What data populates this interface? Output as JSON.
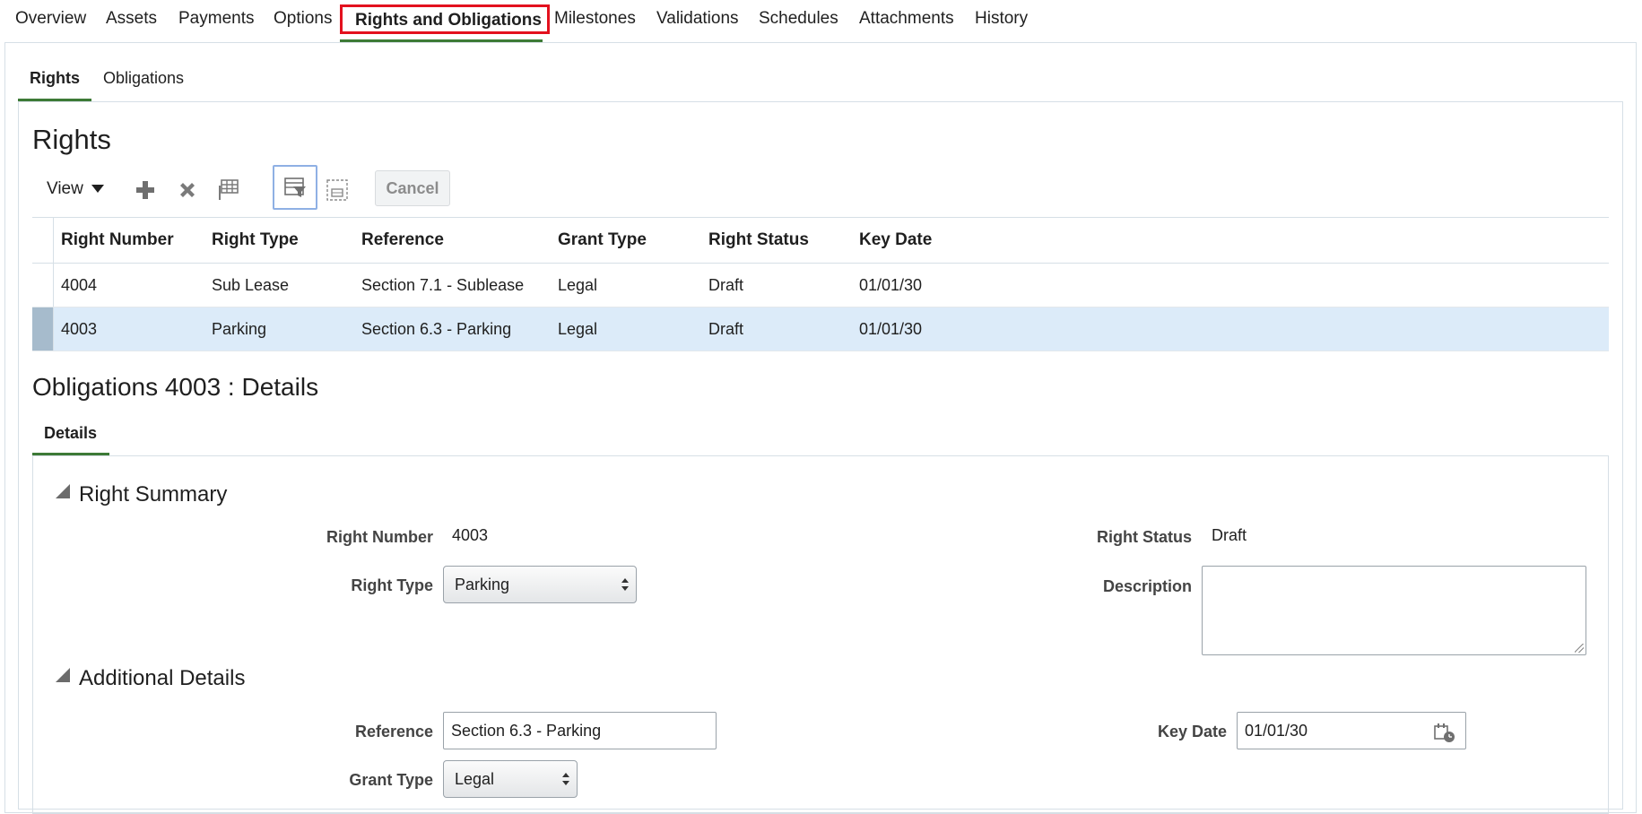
{
  "top_tabs": [
    {
      "label": "Overview"
    },
    {
      "label": "Assets"
    },
    {
      "label": "Payments"
    },
    {
      "label": "Options"
    },
    {
      "label": "Rights and Obligations"
    },
    {
      "label": "Milestones"
    },
    {
      "label": "Validations"
    },
    {
      "label": "Schedules"
    },
    {
      "label": "Attachments"
    },
    {
      "label": "History"
    }
  ],
  "active_top_tab": "Rights and Obligations",
  "sub_tabs": [
    {
      "label": "Rights"
    },
    {
      "label": "Obligations"
    }
  ],
  "rights": {
    "title": "Rights",
    "toolbar": {
      "view_label": "View",
      "cancel_label": "Cancel",
      "icons": [
        "add-icon",
        "delete-icon",
        "freeze-icon",
        "query-by-example-icon",
        "detach-icon"
      ]
    },
    "columns": [
      "Right Number",
      "Right Type",
      "Reference",
      "Grant Type",
      "Right Status",
      "Key Date"
    ],
    "rows": [
      {
        "number": "4004",
        "type": "Sub Lease",
        "reference": "Section 7.1 - Sublease",
        "grant_type": "Legal",
        "status": "Draft",
        "key_date": "01/01/30",
        "selected": false
      },
      {
        "number": "4003",
        "type": "Parking",
        "reference": "Section 6.3 - Parking",
        "grant_type": "Legal",
        "status": "Draft",
        "key_date": "01/01/30",
        "selected": true
      }
    ]
  },
  "details": {
    "title": "Obligations 4003 : Details",
    "tab_label": "Details",
    "right_summary": {
      "header": "Right Summary",
      "right_number_label": "Right Number",
      "right_number": "4003",
      "right_type_label": "Right Type",
      "right_type": "Parking",
      "right_status_label": "Right Status",
      "right_status": "Draft",
      "description_label": "Description",
      "description": ""
    },
    "additional_details": {
      "header": "Additional Details",
      "reference_label": "Reference",
      "reference": "Section 6.3 - Parking",
      "grant_type_label": "Grant Type",
      "grant_type": "Legal",
      "key_date_label": "Key Date",
      "key_date": "01/01/30"
    }
  },
  "colors": {
    "accent_underline": "#3d7a36",
    "highlight_outline": "#e3111e",
    "selected_row": "#dcebf9"
  }
}
